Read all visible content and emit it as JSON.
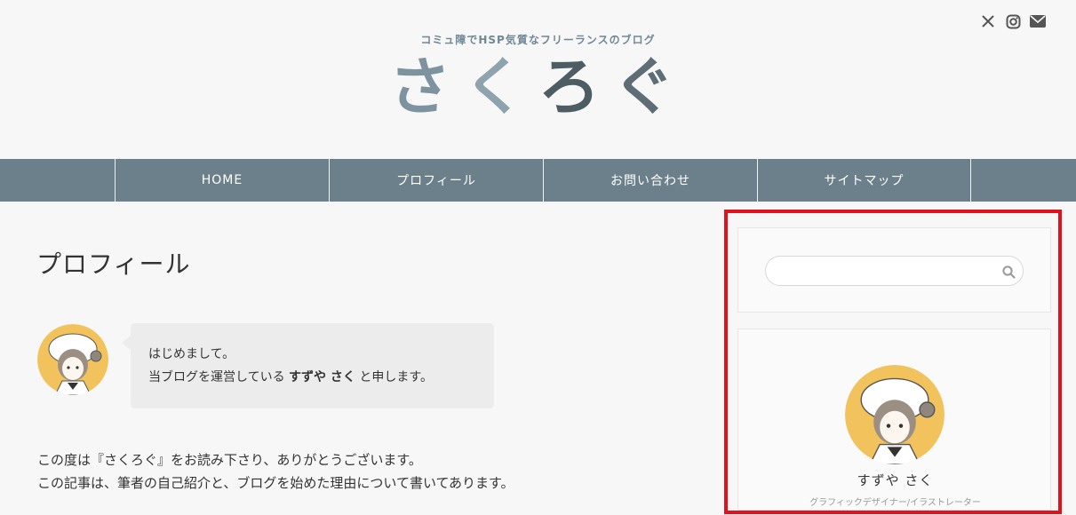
{
  "header": {
    "tagline": "コミュ障でHSP気質なフリーランスのブログ",
    "logo_chars": [
      "さ",
      "く",
      "ろ",
      "ぐ"
    ]
  },
  "social_icons": [
    "x-icon",
    "instagram-icon",
    "mail-icon"
  ],
  "nav": {
    "items": [
      {
        "label": "HOME"
      },
      {
        "label": "プロフィール"
      },
      {
        "label": "お問い合わせ"
      },
      {
        "label": "サイトマップ"
      }
    ]
  },
  "main": {
    "title": "プロフィール",
    "bubble": {
      "line1": "はじめまして。",
      "line2_pre": "当ブログを運営している ",
      "line2_name": "すずや さく",
      "line2_post": " と申します。"
    },
    "paragraph": [
      "この度は『さくろぐ』をお読み下さり、ありがとうございます。",
      "この記事は、筆者の自己紹介と、ブログを始めた理由について書いてあります。"
    ]
  },
  "sidebar": {
    "search": {
      "value": "",
      "placeholder": ""
    },
    "profile": {
      "name": "すずや さく",
      "role": "グラフィックデザイナー/イラストレーター"
    }
  },
  "colors": {
    "nav_bg": "#6c808b",
    "accent_blue": "#6f8896",
    "highlight": "#e0131c",
    "avatar_bg": "#f2c35c"
  }
}
